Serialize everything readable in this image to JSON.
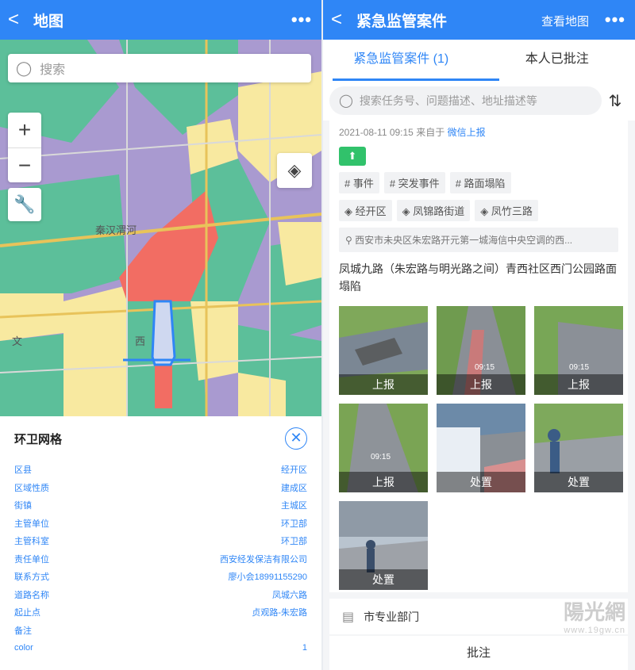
{
  "left": {
    "nav": {
      "back": "<",
      "title": "地图",
      "more": "•••"
    },
    "search": {
      "placeholder": "搜索"
    },
    "map": {
      "place_labels": [
        "秦汉渭河",
        "西",
        "文"
      ],
      "zoom_in": "+",
      "zoom_out": "−"
    },
    "panel": {
      "title": "环卫网格",
      "close": "✕",
      "rows": [
        {
          "label": "区县",
          "value": "经开区"
        },
        {
          "label": "区域性质",
          "value": "建成区"
        },
        {
          "label": "街镇",
          "value": "主城区"
        },
        {
          "label": "主管单位",
          "value": "环卫部"
        },
        {
          "label": "主管科室",
          "value": "环卫部"
        },
        {
          "label": "责任单位",
          "value": "西安经发保洁有限公司"
        },
        {
          "label": "联系方式",
          "value": "廖小会18991155290"
        },
        {
          "label": "道路名称",
          "value": "凤城六路"
        },
        {
          "label": "起止点",
          "value": "贞观路-朱宏路"
        },
        {
          "label": "备注",
          "value": ""
        },
        {
          "label": "color",
          "value": "1"
        }
      ]
    }
  },
  "right": {
    "nav": {
      "back": "<",
      "title": "紧急监管案件",
      "map_link": "查看地图",
      "more": "•••"
    },
    "tabs": [
      {
        "label": "紧急监管案件 (1)"
      },
      {
        "label": "本人已批注"
      }
    ],
    "search": {
      "placeholder": "搜索任务号、问题描述、地址描述等"
    },
    "case": {
      "time": "2021-08-11 09:15",
      "from_prefix": "来自于",
      "source": "微信上报",
      "tags": [
        "# 事件",
        "# 突发事件",
        "# 路面塌陷"
      ],
      "areas": [
        "◈ 经开区",
        "◈ 凤锦路街道",
        "◈ 凤竹三路"
      ],
      "address": "西安市未央区朱宏路开元第一城海信中央空调的西...",
      "description": "凤城九路（朱宏路与明光路之间）青西社区西门公园路面塌陷",
      "photos": [
        {
          "label": "上报"
        },
        {
          "label": "上报",
          "stamp": "09:15"
        },
        {
          "label": "上报",
          "stamp": "09:15"
        },
        {
          "label": "上报",
          "stamp": "09:15"
        },
        {
          "label": "处置"
        },
        {
          "label": "处置"
        },
        {
          "label": "处置"
        }
      ]
    },
    "dept": "市专业部门",
    "approve": "批注",
    "watermark": {
      "main": "陽光網",
      "sub": "www.19gw.cn"
    }
  },
  "colors": {
    "primary": "#2f86f6",
    "green_badge": "#31c26b",
    "map_red": "#f26d63",
    "map_yellow": "#f8e9a0",
    "map_teal": "#5cbf9a",
    "map_purple": "#a99ad0"
  }
}
